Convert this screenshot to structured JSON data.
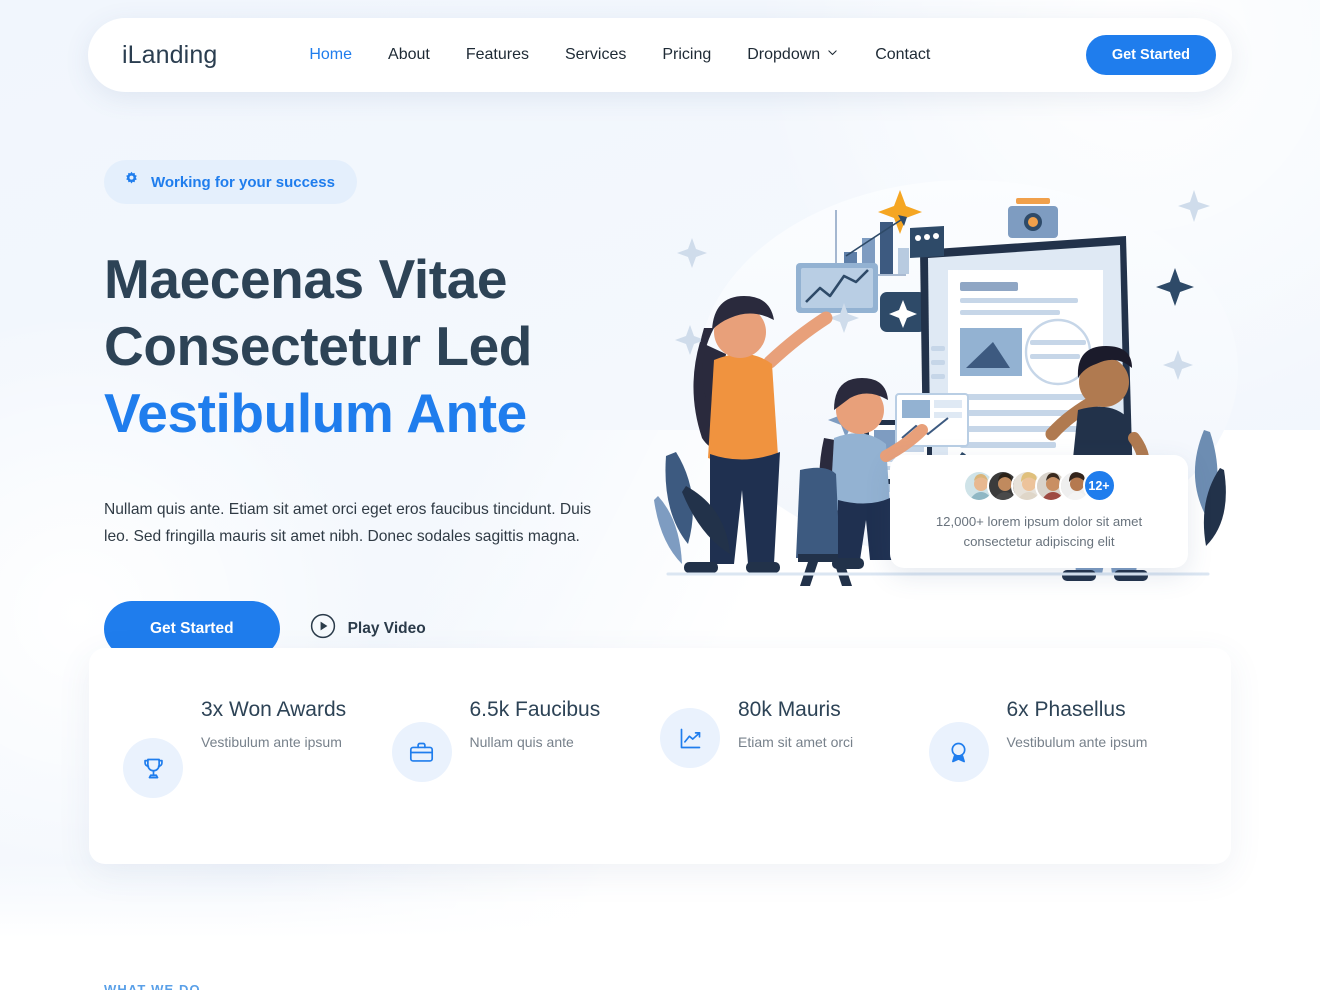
{
  "header": {
    "logo": "iLanding",
    "nav": [
      {
        "label": "Home",
        "active": true
      },
      {
        "label": "About",
        "active": false
      },
      {
        "label": "Features",
        "active": false
      },
      {
        "label": "Services",
        "active": false
      },
      {
        "label": "Pricing",
        "active": false
      },
      {
        "label": "Dropdown",
        "active": false,
        "icon": "chevron-down-icon"
      },
      {
        "label": "Contact",
        "active": false
      }
    ],
    "cta_label": "Get Started"
  },
  "hero": {
    "badge": {
      "icon": "gear-icon",
      "text": "Working for your success"
    },
    "title_line1": "Maecenas Vitae",
    "title_line2": "Consectetur Led",
    "title_line3": "Vestibulum Ante",
    "subtitle": "Nullam quis ante. Etiam sit amet orci eget eros faucibus tincidunt. Duis leo. Sed fringilla mauris sit amet nibh. Donec sodales sagittis magna.",
    "primary_cta": "Get Started",
    "play_label": "Play Video",
    "play_icon": "play-circle-icon"
  },
  "testimonial": {
    "badge_count": "12+",
    "text": "12,000+ lorem ipsum dolor sit amet consectetur adipiscing elit"
  },
  "stats": [
    {
      "icon": "trophy-icon",
      "value": "3x Won Awards",
      "desc": "Vestibulum ante ipsum"
    },
    {
      "icon": "briefcase-icon",
      "value": "6.5k Faucibus",
      "desc": "Nullam quis ante"
    },
    {
      "icon": "chart-line-icon",
      "value": "80k Mauris",
      "desc": "Etiam sit amet orci"
    },
    {
      "icon": "award-medal-icon",
      "value": "6x Phasellus",
      "desc": "Vestibulum ante ipsum"
    }
  ],
  "next_section": {
    "label": "WHAT WE DO"
  },
  "colors": {
    "accent": "#1f7ded",
    "heading": "#2d4356",
    "body": "#303b45",
    "muted": "#77818b",
    "page_bg": "#f3f7fc",
    "badge_bg": "#e4effc",
    "card_bg": "#ffffff"
  }
}
